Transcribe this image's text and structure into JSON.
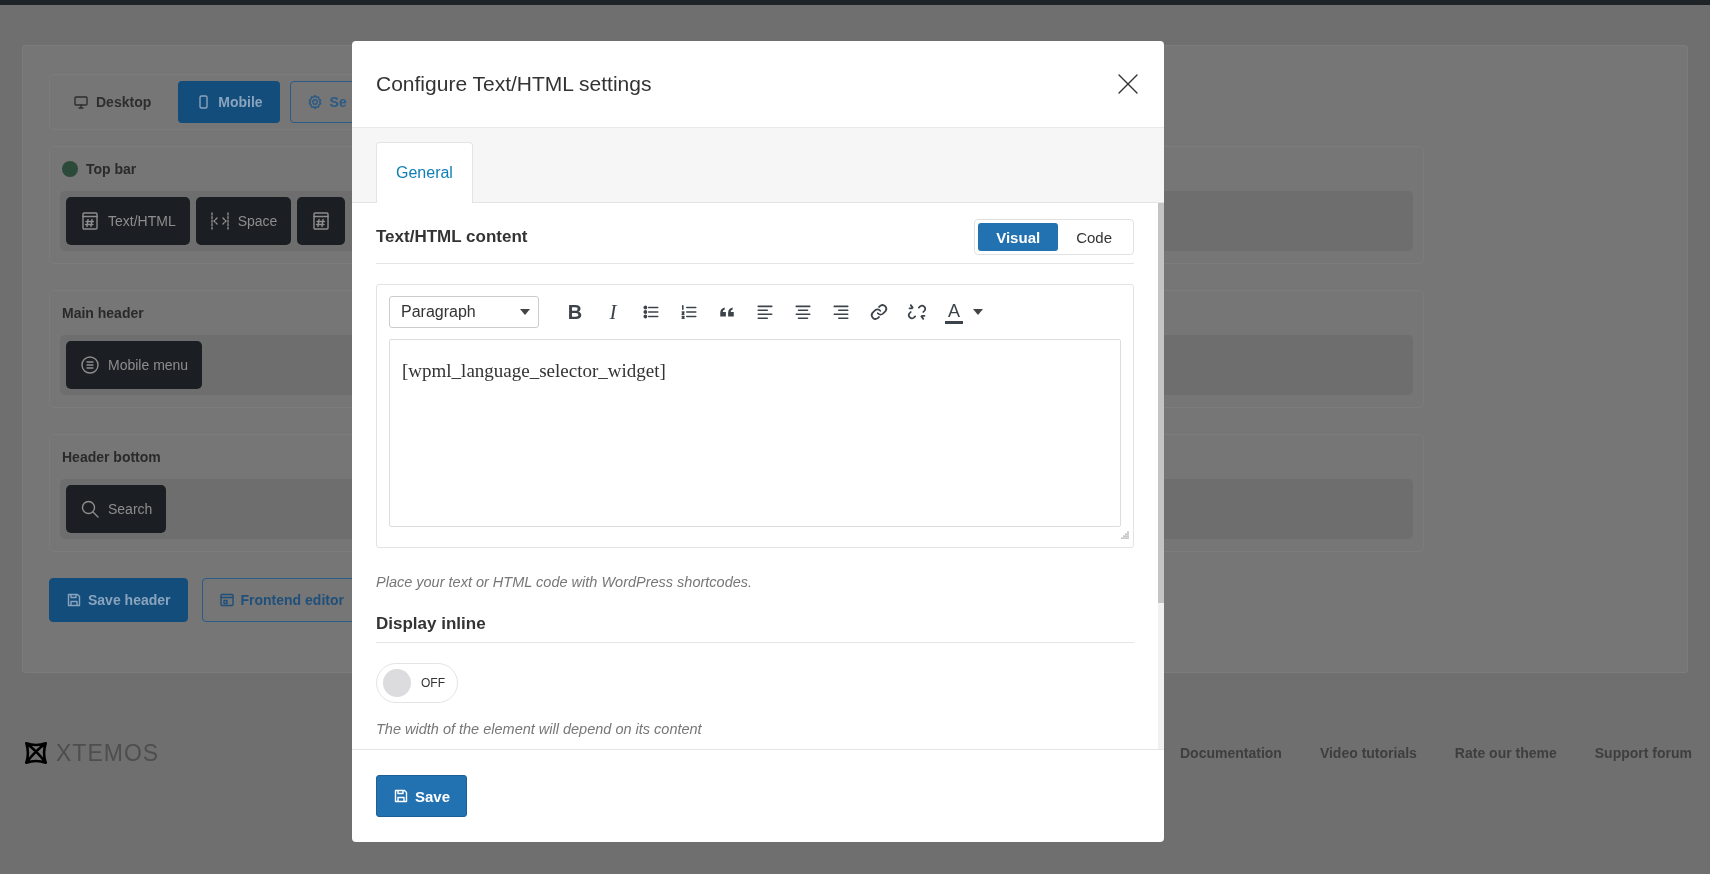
{
  "background": {
    "device_tabs": [
      {
        "label": "Desktop",
        "kind": "desktop",
        "selected": false
      },
      {
        "label": "Mobile",
        "kind": "mobile",
        "selected": true
      },
      {
        "label": "Se",
        "kind": "settings",
        "selected": false
      }
    ],
    "sections": [
      {
        "title": "Top bar",
        "indicator": true,
        "elements": [
          {
            "kind": "html",
            "label": "Text/HTML"
          },
          {
            "kind": "space",
            "label": "Space"
          },
          {
            "kind": "html"
          }
        ]
      },
      {
        "title": "Main header",
        "indicator": false,
        "elements": [
          {
            "kind": "menu",
            "label": "Mobile menu"
          }
        ]
      },
      {
        "title": "Header bottom",
        "indicator": false,
        "elements": [
          {
            "kind": "search",
            "label": "Search"
          }
        ]
      }
    ],
    "actions": [
      {
        "kind": "primary",
        "label": "Save header"
      },
      {
        "kind": "outline",
        "label": "Frontend editor"
      }
    ],
    "logo": "XTEMOS",
    "footer_links": [
      "Documentation",
      "Video tutorials",
      "Rate our theme",
      "Support forum"
    ]
  },
  "modal": {
    "title": "Configure Text/HTML settings",
    "tabs": [
      {
        "label": "General",
        "selected": true
      }
    ],
    "content_section": {
      "title": "Text/HTML content",
      "modes": [
        {
          "label": "Visual",
          "selected": true
        },
        {
          "label": "Code",
          "selected": false
        }
      ]
    },
    "editor": {
      "format": "Paragraph",
      "toolbar": [
        {
          "kind": "bold",
          "glyph": "B"
        },
        {
          "kind": "italic",
          "glyph": "I"
        },
        {
          "kind": "bullets"
        },
        {
          "kind": "numbers"
        },
        {
          "kind": "quote"
        },
        {
          "kind": "align-left"
        },
        {
          "kind": "align-center"
        },
        {
          "kind": "align-right"
        },
        {
          "kind": "link"
        },
        {
          "kind": "unlink"
        },
        {
          "kind": "text-color",
          "glyph": "A"
        }
      ],
      "value": "[wpml_language_selector_widget]"
    },
    "help": "Place your text or HTML code with WordPress shortcodes.",
    "display_inline": {
      "title": "Display inline",
      "on": false,
      "state_label": "OFF",
      "help": "The width of the element will depend on its content"
    },
    "save_label": "Save"
  }
}
